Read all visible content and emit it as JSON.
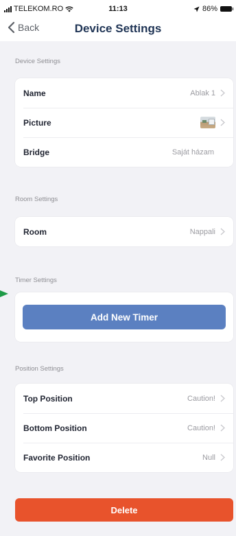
{
  "status_bar": {
    "carrier": "TELEKOM.RO",
    "time": "11:13",
    "battery": "86%"
  },
  "nav": {
    "back_label": "Back",
    "title": "Device Settings"
  },
  "device_settings": {
    "section_label": "Device Settings",
    "rows": [
      {
        "label": "Name",
        "value": "Ablak 1"
      },
      {
        "label": "Picture",
        "value": ""
      },
      {
        "label": "Bridge",
        "value": "Saját házam"
      }
    ]
  },
  "room_settings": {
    "section_label": "Room Settings",
    "rows": [
      {
        "label": "Room",
        "value": "Nappali"
      }
    ]
  },
  "timer_settings": {
    "section_label": "Timer Settings",
    "add_timer_label": "Add New Timer",
    "accent_color": "#5b80c1"
  },
  "position_settings": {
    "section_label": "Position Settings",
    "rows": [
      {
        "label": "Top Position",
        "value": "Caution!"
      },
      {
        "label": "Bottom Position",
        "value": "Caution!"
      },
      {
        "label": "Favorite Position",
        "value": "Null"
      }
    ]
  },
  "delete_label": "Delete",
  "delete_color": "#e8532c",
  "icons": {
    "back": "chevron-left-icon",
    "row_chevron": "chevron-right-icon",
    "picture_thumbnail": "room-photo-thumbnail",
    "annotation_marker": "green-arrow-marker"
  }
}
